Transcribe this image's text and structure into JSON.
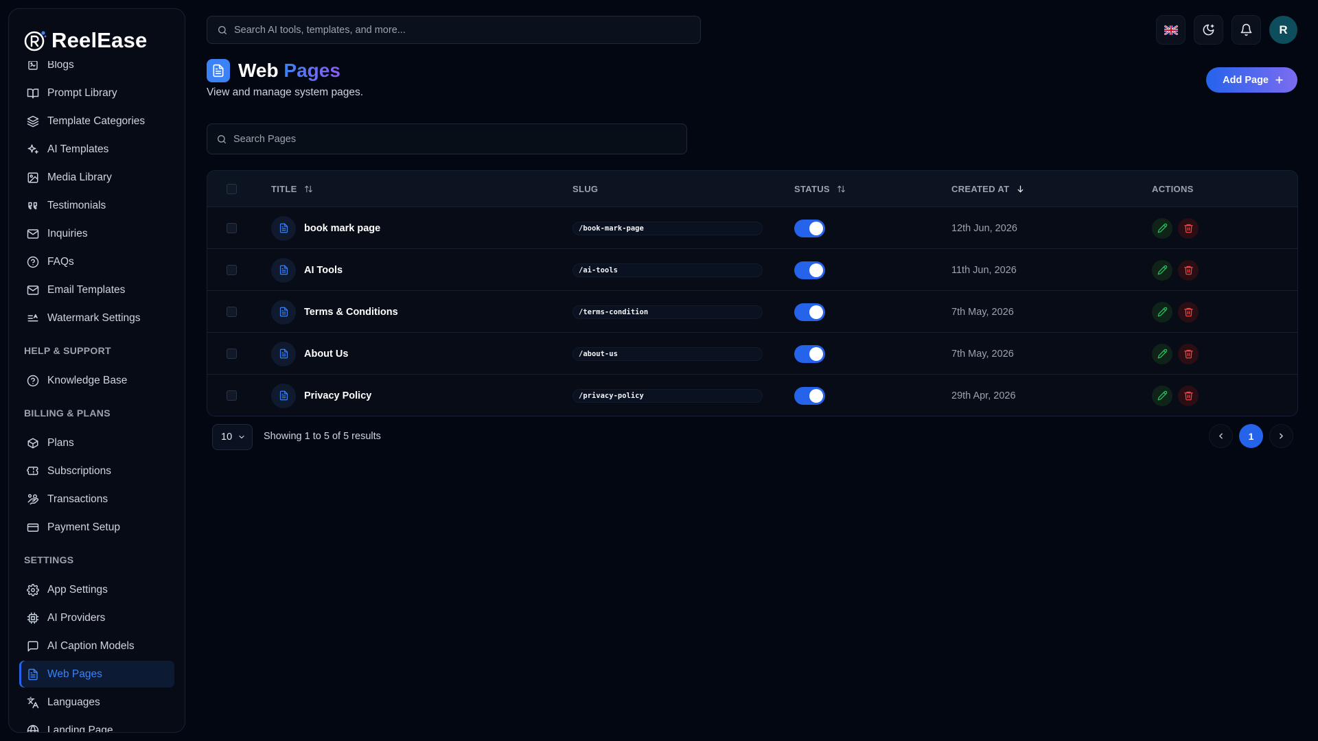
{
  "brand": {
    "name": "ReelEase"
  },
  "sidebar": {
    "items_top": [
      {
        "label": "Blogs",
        "icon": "blog-icon"
      },
      {
        "label": "Prompt Library",
        "icon": "book-open-icon"
      },
      {
        "label": "Template Categories",
        "icon": "layers-icon"
      },
      {
        "label": "AI Templates",
        "icon": "sparkles-icon"
      },
      {
        "label": "Media Library",
        "icon": "image-icon"
      },
      {
        "label": "Testimonials",
        "icon": "quote-icon"
      },
      {
        "label": "Inquiries",
        "icon": "mail-icon"
      },
      {
        "label": "FAQs",
        "icon": "help-circle-icon"
      },
      {
        "label": "Email Templates",
        "icon": "mail-icon"
      },
      {
        "label": "Watermark Settings",
        "icon": "watermark-icon"
      }
    ],
    "section_help": "HELP & SUPPORT",
    "items_help": [
      {
        "label": "Knowledge Base",
        "icon": "help-circle-icon"
      }
    ],
    "section_billing": "BILLING & PLANS",
    "items_billing": [
      {
        "label": "Plans",
        "icon": "package-icon"
      },
      {
        "label": "Subscriptions",
        "icon": "ticket-icon"
      },
      {
        "label": "Transactions",
        "icon": "hand-coins-icon"
      },
      {
        "label": "Payment Setup",
        "icon": "credit-card-icon"
      }
    ],
    "section_settings": "SETTINGS",
    "items_settings": [
      {
        "label": "App Settings",
        "icon": "gear-icon"
      },
      {
        "label": "AI Providers",
        "icon": "cpu-icon"
      },
      {
        "label": "AI Caption Models",
        "icon": "message-square-icon"
      },
      {
        "label": "Web Pages",
        "icon": "file-text-icon",
        "active": true
      },
      {
        "label": "Languages",
        "icon": "languages-icon"
      },
      {
        "label": "Landing Page",
        "icon": "globe-icon"
      }
    ]
  },
  "topbar": {
    "search_placeholder": "Search AI tools, templates, and more...",
    "avatar_initial": "R"
  },
  "header": {
    "title_main": "Web",
    "title_accent": "Pages",
    "subtitle": "View and manage system pages.",
    "add_button": "Add Page"
  },
  "search": {
    "placeholder": "Search Pages"
  },
  "table": {
    "columns": {
      "title": "TITLE",
      "slug": "SLUG",
      "status": "STATUS",
      "created_at": "CREATED AT",
      "actions": "ACTIONS"
    },
    "rows": [
      {
        "title": "book mark page",
        "slug": "/book-mark-page",
        "status": true,
        "created_at": "12th Jun, 2026"
      },
      {
        "title": "AI Tools",
        "slug": "/ai-tools",
        "status": true,
        "created_at": "11th Jun, 2026"
      },
      {
        "title": "Terms & Conditions",
        "slug": "/terms-condition",
        "status": true,
        "created_at": "7th May, 2026"
      },
      {
        "title": "About Us",
        "slug": "/about-us",
        "status": true,
        "created_at": "7th May, 2026"
      },
      {
        "title": "Privacy Policy",
        "slug": "/privacy-policy",
        "status": true,
        "created_at": "29th Apr, 2026"
      }
    ]
  },
  "pagination": {
    "per_page": "10",
    "summary": "Showing 1 to 5 of 5 results",
    "current_page": "1"
  },
  "colors": {
    "accent": "#2563eb",
    "background": "#030712",
    "edit": "#22c55e",
    "delete": "#ef4444"
  }
}
